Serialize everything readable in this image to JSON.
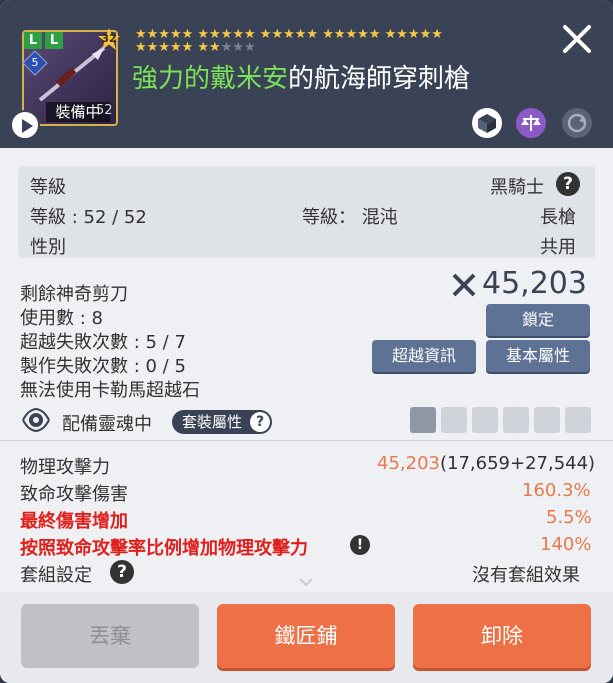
{
  "header": {
    "stars_on": "★★★★★ ★★★★★ ★★★★★ ★★★★★ ★★★★★ ★★★★★ ★★",
    "stars_off": "★★★",
    "title_prefix": "強力的戴米安",
    "title_rest": "的航海師穿刺槍",
    "item_level": "32",
    "item_tier": "5",
    "equip_label": "裝備中",
    "equip_num": "52",
    "tag_l1": "L",
    "tag_l2": "L",
    "close_icon": "close-icon"
  },
  "info": {
    "level_label": "等級",
    "job": "黑騎士",
    "level_value": "等級 : 52 / 52",
    "grade": "等級： 混沌",
    "weapon_type": "長槍",
    "gender_label": "性別",
    "gender_value": "共用"
  },
  "stats": {
    "scissors": "剩餘神奇剪刀",
    "uses": "使用數 : 8",
    "exceed_fail": "超越失敗次數 : 5 / 7",
    "craft_fail": "製作失敗次數 : 0 / 5",
    "no_karma": "無法使用卡勒馬超越石",
    "power": "45,203"
  },
  "buttons": {
    "lock": "鎖定",
    "exceed_info": "超越資訊",
    "basic_attr": "基本屬性",
    "discard": "丟棄",
    "smith": "鐵匠鋪",
    "unequip": "卸除"
  },
  "soul": {
    "label": "配備靈魂中",
    "set_attr": "套裝屬性"
  },
  "attributes": [
    {
      "label": "物理攻擊力",
      "value": "45,203",
      "extra": "(17,659+27,544)"
    },
    {
      "label": "致命攻擊傷害",
      "value": "160.3%"
    },
    {
      "label": "最終傷害增加",
      "value": "5.5%"
    },
    {
      "label": "按照致命攻擊率比例增加物理攻擊力",
      "value": "140%"
    },
    {
      "label": "套組設定",
      "value": "沒有套組效果"
    }
  ],
  "colors": {
    "accent_orange": "#ee7046",
    "header_bg": "#3a4356",
    "red_text": "#e0201c"
  }
}
